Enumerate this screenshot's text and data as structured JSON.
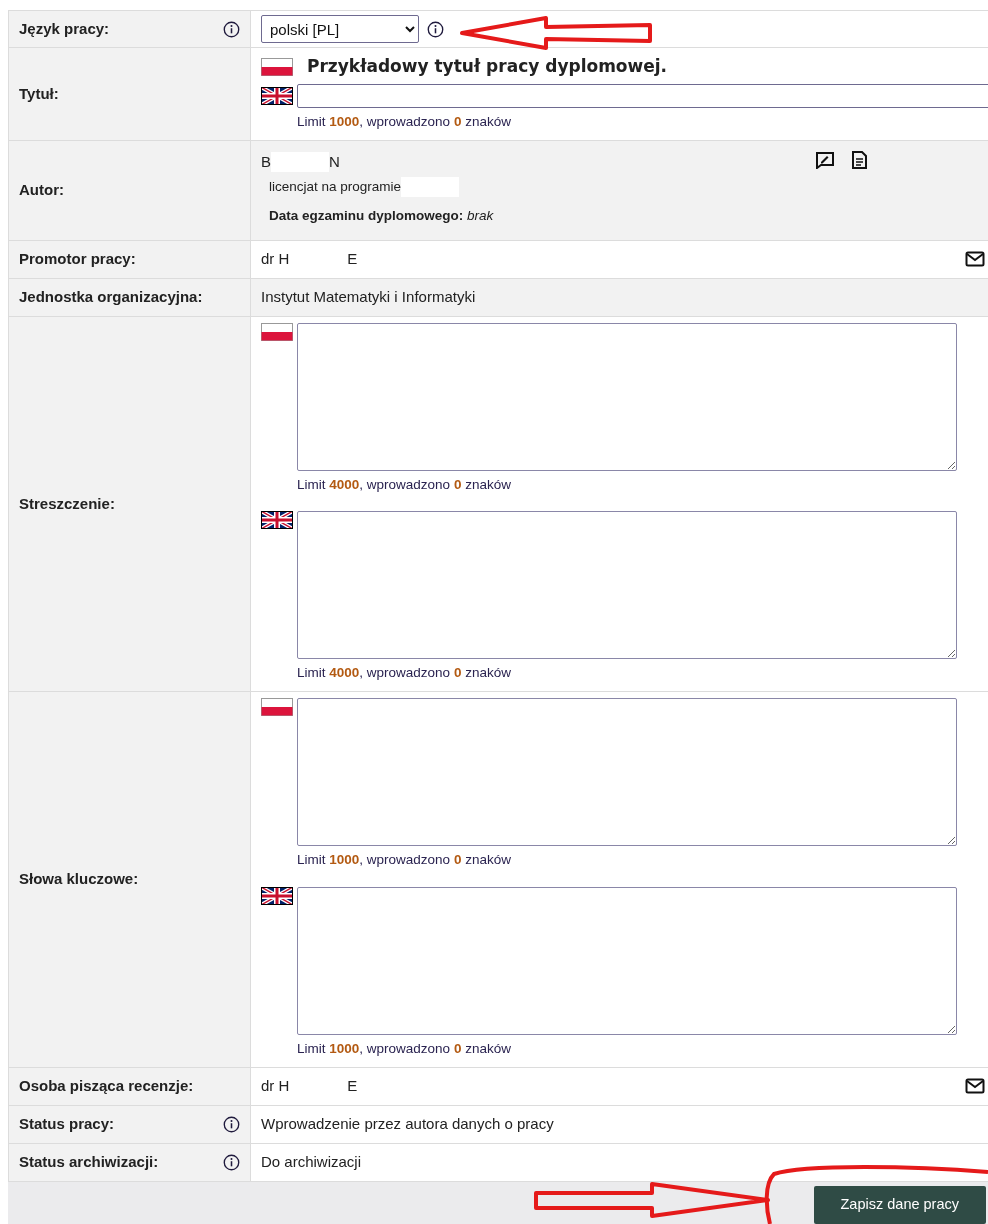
{
  "rows": [
    {
      "label": "Język pracy:",
      "kind": "select",
      "striped": false,
      "value": "polski [PL]",
      "info": true
    },
    {
      "label": "Tytuł:",
      "kind": "title",
      "striped": false,
      "entries": [
        {
          "kind": "polish",
          "text": "Przykładowy tytuł pracy dyplomowej."
        },
        {
          "kind": "english",
          "counter": "Limit **1000**, wprowadzono **0** znaków"
        }
      ]
    },
    {
      "label": "Autor:",
      "kind": "author",
      "striped": true,
      "name_parts": [
        "B",
        "N"
      ],
      "program": "licencjat na programie",
      "exam": "**Data egzaminu dyplomowego:** *brak*"
    },
    {
      "label": "Promotor pracy:",
      "kind": "person",
      "striped": false,
      "name_parts": [
        "dr H",
        "E"
      ]
    },
    {
      "label": "Jednostka organizacyjna:",
      "kind": "text",
      "striped": true,
      "text": "Instytut Matematyki i Informatyki"
    },
    {
      "label": "Streszczenie:",
      "kind": "textareas",
      "striped": false,
      "entries": [
        {
          "kind": "polish",
          "counter": "Limit **4000**, wprowadzono **0** znaków"
        },
        {
          "kind": "english",
          "counter": "Limit **4000**, wprowadzono **0** znaków"
        }
      ]
    },
    {
      "label": "Słowa kluczowe:",
      "kind": "textareas",
      "striped": false,
      "entries": [
        {
          "kind": "polish",
          "counter": "Limit **1000**, wprowadzono **0** znaków"
        },
        {
          "kind": "english",
          "counter": "Limit **1000**, wprowadzono **0** znaków"
        }
      ]
    },
    {
      "label": "Osoba pisząca recenzje:",
      "kind": "person",
      "striped": false,
      "name_parts": [
        "dr H",
        "E"
      ]
    },
    {
      "label": "Status pracy:",
      "kind": "text",
      "striped": false,
      "info": true,
      "text": "Wprowadzenie przez autora danych o pracy"
    },
    {
      "label": "Status archiwizacji:",
      "kind": "text",
      "striped": false,
      "info": true,
      "text": "Do archiwizacji"
    }
  ],
  "save_button": "Zapisz dane pracy"
}
